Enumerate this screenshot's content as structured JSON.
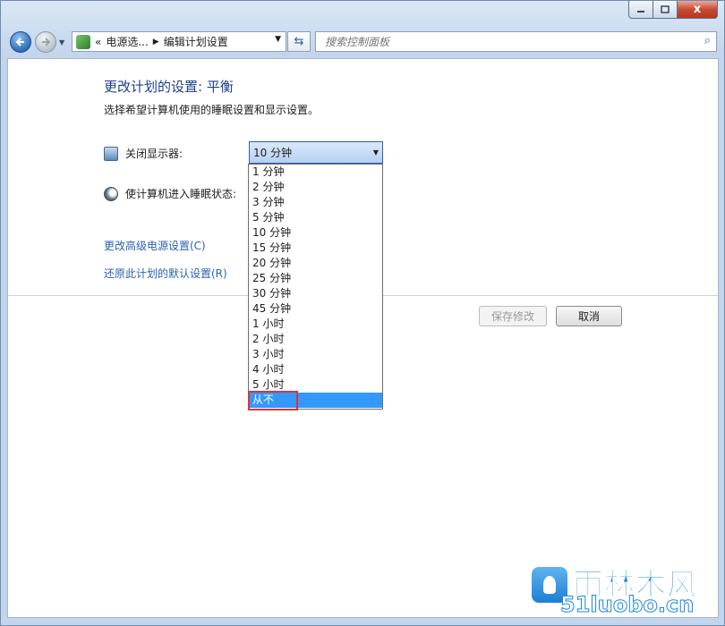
{
  "window": {
    "min_icon": "minimize-icon",
    "max_icon": "maximize-icon",
    "close_glyph": "x"
  },
  "nav": {
    "breadcrumb_prefix": "«",
    "breadcrumb": [
      "电源选...",
      "编辑计划设置"
    ],
    "search_placeholder": "搜索控制面板"
  },
  "page": {
    "title": "更改计划的设置: 平衡",
    "subtitle": "选择希望计算机使用的睡眠设置和显示设置。",
    "display_off_label": "关闭显示器:",
    "sleep_label": "使计算机进入睡眠状态:",
    "display_off_value": "10 分钟",
    "link_advanced": "更改高级电源设置(C)",
    "link_restore": "还原此计划的默认设置(R)",
    "save_button": "保存修改",
    "cancel_button": "取消"
  },
  "dropdown": {
    "options": [
      "1 分钟",
      "2 分钟",
      "3 分钟",
      "5 分钟",
      "10 分钟",
      "15 分钟",
      "20 分钟",
      "25 分钟",
      "30 分钟",
      "45 分钟",
      "1 小时",
      "2 小时",
      "3 小时",
      "4 小时",
      "5 小时",
      "从不"
    ],
    "highlighted_index": 15
  },
  "watermark": {
    "chinese": "雨林木风",
    "url": "51luobo.cn"
  },
  "colors": {
    "title_blue": "#1e3e8c",
    "link_blue": "#2a63b0",
    "selection": "#3399ff",
    "highlight_box": "#d9343d"
  }
}
